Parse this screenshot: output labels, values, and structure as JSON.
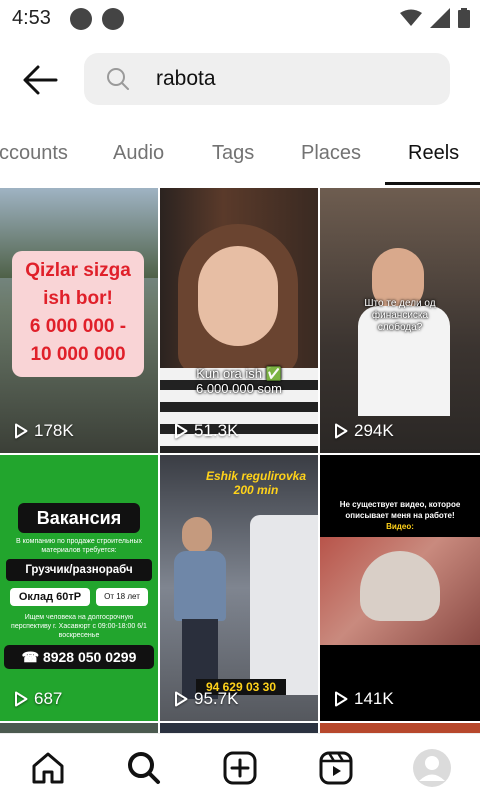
{
  "status": {
    "time": "4:53"
  },
  "search": {
    "query": "rabota"
  },
  "tabs": [
    {
      "label": "ccounts"
    },
    {
      "label": "Audio"
    },
    {
      "label": "Tags"
    },
    {
      "label": "Places"
    },
    {
      "label": "Reels"
    }
  ],
  "active_tab": "Reels",
  "reels": [
    {
      "views": "178K",
      "caption": [
        "Qizlar sizga",
        "ish bor!",
        "6 000 000 -",
        "10 000 000"
      ]
    },
    {
      "views": "51.3K",
      "caption": [
        "Kun ora ish ✅",
        "6.000.000 som"
      ]
    },
    {
      "views": "294K",
      "caption": [
        "Што те дели од",
        "финансиска",
        "слобода?"
      ]
    },
    {
      "views": "687",
      "vacancy_title": "Вакансия",
      "vacancy_intro": "В компанию по продаже строительных материалов требуется:",
      "vacancy_role": "Грузчик/разнорабч",
      "vacancy_salary": "Оклад 60тР",
      "vacancy_age": "От 18 лет",
      "vacancy_details": "Ищем человека на долгосрочную перспективу г. Хасавюрт с 09:00-18:00 6/1 воскресенье",
      "vacancy_phone": "☎ 8928 050 0299"
    },
    {
      "views": "95.7K",
      "caption": [
        "Eshik regulirovka",
        "200 min"
      ],
      "phone_overlay": "94 629 03 30"
    },
    {
      "views": "141K",
      "caption": [
        "Не существует видео, которое",
        "описывает меня на работе!",
        "Видео:"
      ]
    }
  ],
  "nav": {
    "icons": [
      "home-icon",
      "search-icon",
      "create-icon",
      "reels-icon",
      "profile-icon"
    ]
  }
}
